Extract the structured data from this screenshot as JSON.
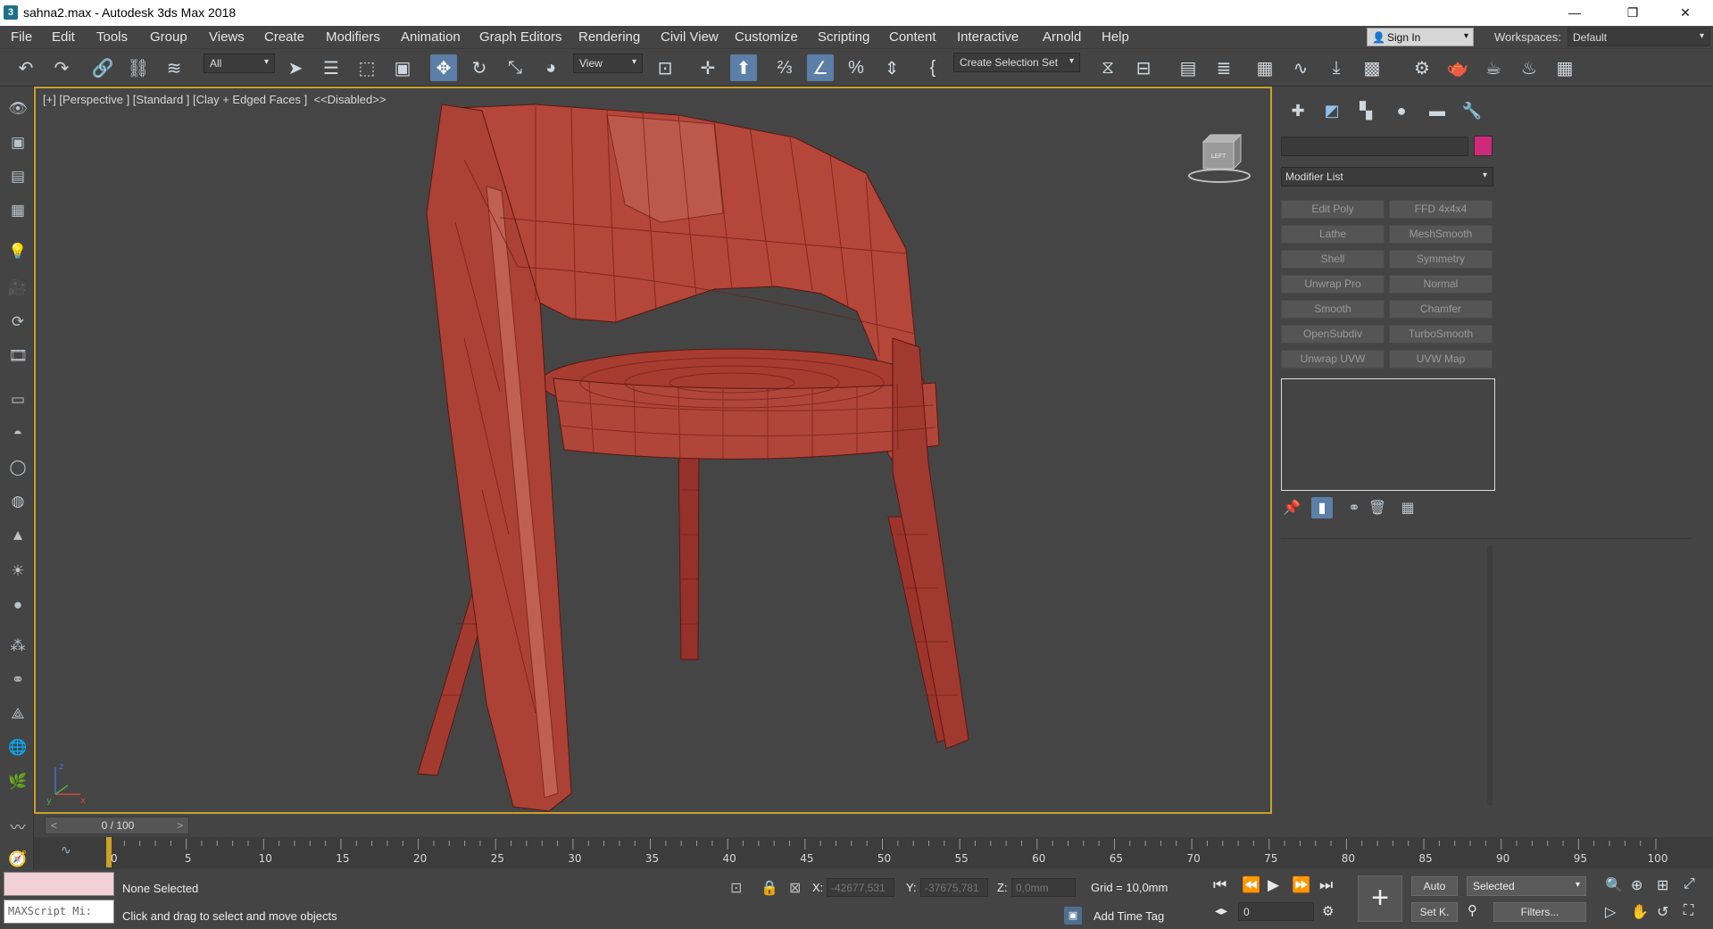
{
  "window": {
    "app_icon": "3",
    "title": "sahna2.max - Autodesk 3ds Max 2018",
    "minimize": "—",
    "restore": "❐",
    "close": "✕"
  },
  "menu": [
    "File",
    "Edit",
    "Tools",
    "Group",
    "Views",
    "Create",
    "Modifiers",
    "Animation",
    "Graph Editors",
    "Rendering",
    "Civil View",
    "Customize",
    "Scripting",
    "Content",
    "Interactive",
    "Arnold",
    "Help"
  ],
  "signin": {
    "label": "Sign In",
    "arrow": "▾"
  },
  "workspaces": {
    "label": "Workspaces:",
    "value": "Default",
    "arrow": "▾"
  },
  "toolbar": {
    "filter_value": "All",
    "refcoord_value": "View",
    "selection_set_placeholder": "Create Selection Set",
    "arrow": "▾"
  },
  "viewport": {
    "label": "[+] [Perspective ] [Standard ] [Clay + Edged Faces ]  <<Disabled>>",
    "viewcube_face": "LEFT",
    "axis_x": "x",
    "axis_y": "y",
    "axis_z": "z",
    "object_color": "#a8392f"
  },
  "command_panel": {
    "modifier_list": "Modifier List",
    "object_color": "#cf2a7a",
    "modifier_buttons": [
      [
        "Edit Poly",
        "FFD 4x4x4"
      ],
      [
        "Lathe",
        "MeshSmooth"
      ],
      [
        "Shell",
        "Symmetry"
      ],
      [
        "Unwrap Pro",
        "Normal"
      ],
      [
        "Smooth",
        "Chamfer"
      ],
      [
        "OpenSubdiv",
        "TurboSmooth"
      ],
      [
        "Unwrap UVW",
        "UVW Map"
      ]
    ]
  },
  "timeslider": {
    "position": "0 / 100",
    "prev": "<",
    "next": ">"
  },
  "trackbar": {
    "ticks": [
      "0",
      "5",
      "10",
      "15",
      "20",
      "25",
      "30",
      "35",
      "40",
      "45",
      "50",
      "55",
      "60",
      "65",
      "70",
      "75",
      "80",
      "85",
      "90",
      "95",
      "100"
    ]
  },
  "status": {
    "maxscript_text": "MAXScript Mi:",
    "selection": "None Selected",
    "prompt": "Click and drag to select and move objects",
    "x_label": "X:",
    "x_value": "-42677,531",
    "y_label": "Y:",
    "y_value": "-37675,781",
    "z_label": "Z:",
    "z_value": "0,0mm",
    "grid": "Grid = 10,0mm",
    "add_time_tag": "Add Time Tag",
    "frame": "0",
    "auto_key": "Auto",
    "set_key": "Set K.",
    "selected": "Selected",
    "filters": "Filters..."
  }
}
